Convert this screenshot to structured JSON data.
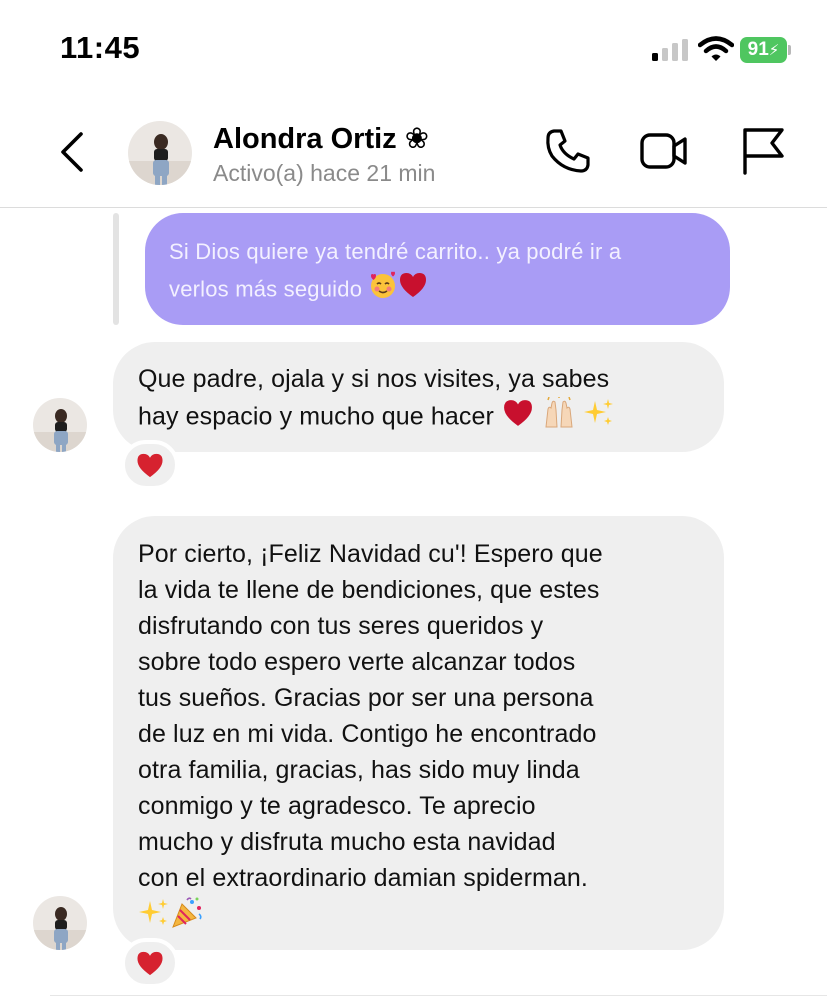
{
  "status_bar": {
    "time": "11:45",
    "battery": "91",
    "battery_color": "#4fc660"
  },
  "header": {
    "back_icon": "chevron-left-icon",
    "contact_name": "Alondra Ortiz ❀",
    "activity": "Activo(a) hace 21 min",
    "actions": [
      "phone-icon",
      "video-camera-icon",
      "flag-icon"
    ]
  },
  "messages": {
    "sent": {
      "lines": [
        "Si Dios quiere ya tendré carrito.. ya podré ir a",
        "verlos más seguido"
      ],
      "color": "#a99cf5"
    },
    "received_1": {
      "lines": [
        "Que padre, ojala y si nos visites, ya sabes",
        "hay espacio y mucho que hacer"
      ],
      "reaction": "heart"
    },
    "received_2": {
      "lines": [
        "Por cierto, ¡Feliz Navidad cu'! Espero que",
        "la vida te llene de bendiciones, que estes",
        "disfrutando con tus seres queridos y",
        "sobre todo espero verte alcanzar todos",
        "tus sueños. Gracias por ser una persona",
        "de luz en mi vida.  Contigo he encontrado",
        "otra familia, gracias, has sido muy linda",
        "conmigo y te agradesco. Te aprecio",
        "mucho y disfruta mucho esta navidad",
        "con el extraordinario damian spiderman."
      ],
      "reaction": "heart"
    }
  },
  "colors": {
    "received_bubble": "#efefef",
    "heart": "#d6222f"
  }
}
